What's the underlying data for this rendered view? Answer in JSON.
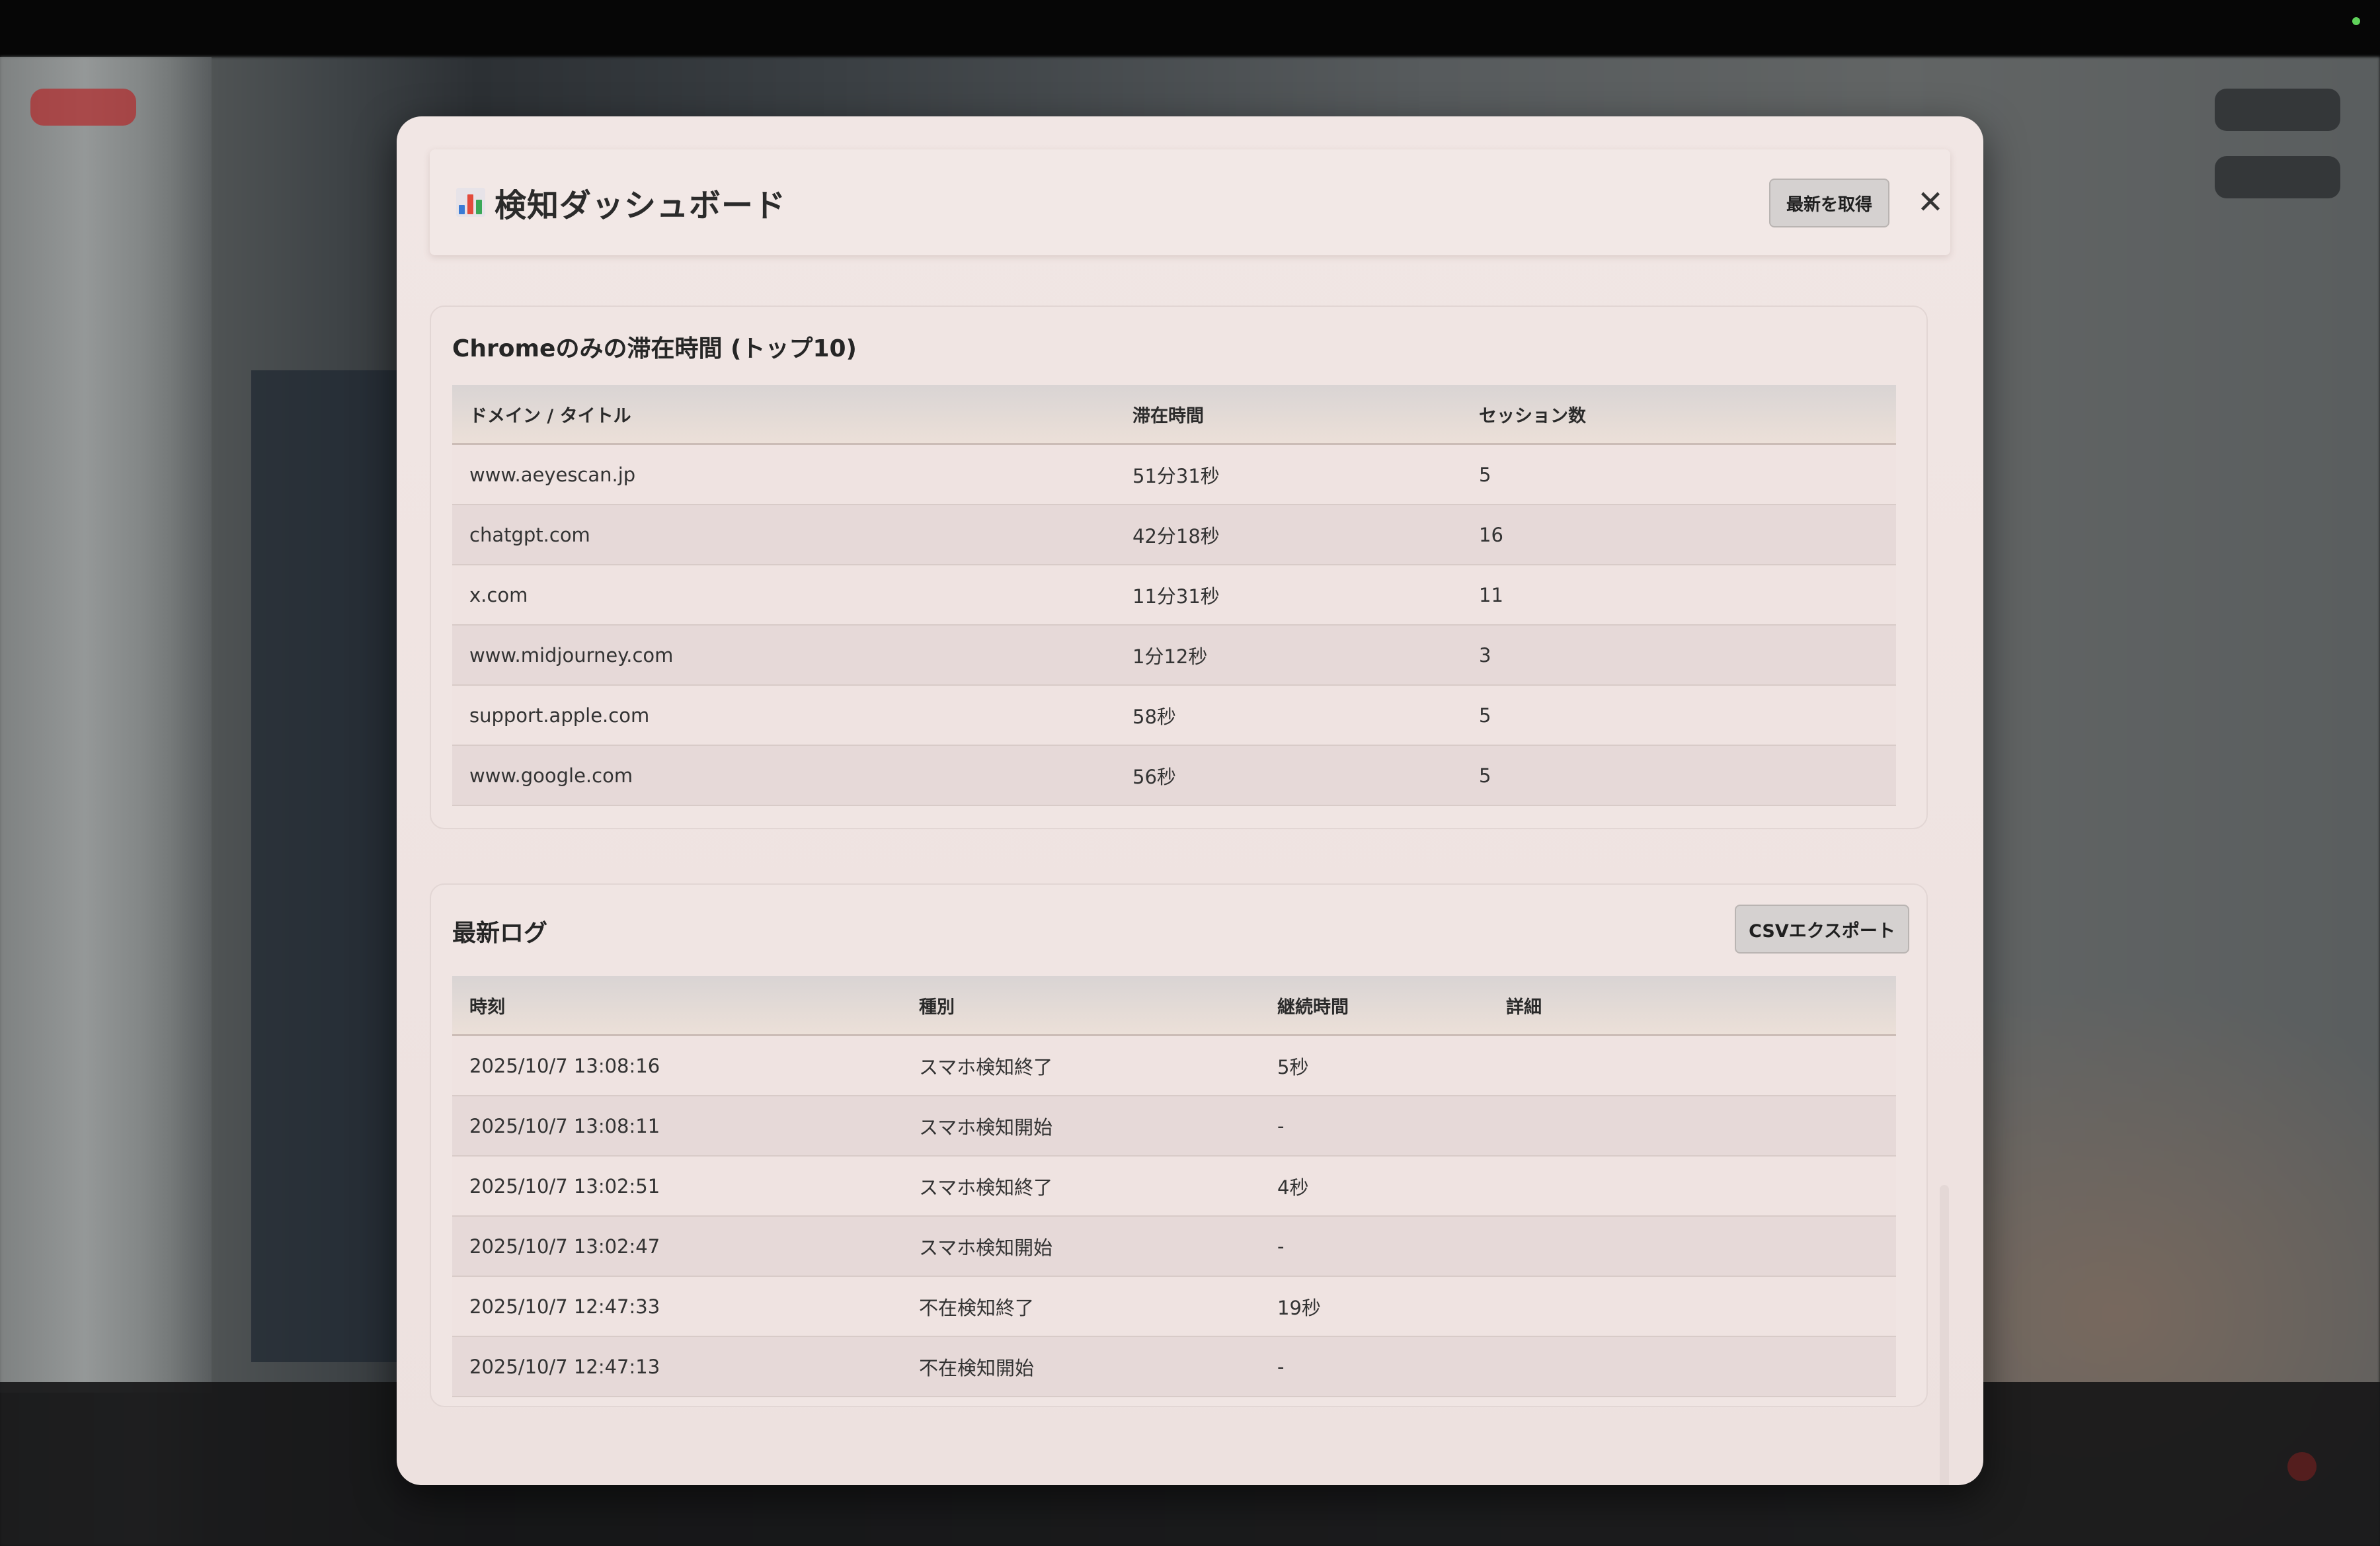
{
  "dashboard": {
    "title": "検知ダッシュボード",
    "refresh_label": "最新を取得",
    "close_label": "✕"
  },
  "chrome_section": {
    "title": "Chromeのみの滞在時間 (トップ10)",
    "columns": [
      "ドメイン / タイトル",
      "滞在時間",
      "セッション数"
    ],
    "rows": [
      {
        "domain": "www.aeyescan.jp",
        "time": "51分31秒",
        "sessions": "5"
      },
      {
        "domain": "chatgpt.com",
        "time": "42分18秒",
        "sessions": "16"
      },
      {
        "domain": "x.com",
        "time": "11分31秒",
        "sessions": "11"
      },
      {
        "domain": "www.midjourney.com",
        "time": "1分12秒",
        "sessions": "3"
      },
      {
        "domain": "support.apple.com",
        "time": "58秒",
        "sessions": "5"
      },
      {
        "domain": "www.google.com",
        "time": "56秒",
        "sessions": "5"
      }
    ]
  },
  "log_section": {
    "title": "最新ログ",
    "csv_label": "CSVエクスポート",
    "columns": [
      "時刻",
      "種別",
      "継続時間",
      "詳細"
    ],
    "rows": [
      {
        "time": "2025/10/7 13:08:16",
        "type": "スマホ検知終了",
        "duration": "5秒",
        "detail": ""
      },
      {
        "time": "2025/10/7 13:08:11",
        "type": "スマホ検知開始",
        "duration": "-",
        "detail": ""
      },
      {
        "time": "2025/10/7 13:02:51",
        "type": "スマホ検知終了",
        "duration": "4秒",
        "detail": ""
      },
      {
        "time": "2025/10/7 13:02:47",
        "type": "スマホ検知開始",
        "duration": "-",
        "detail": ""
      },
      {
        "time": "2025/10/7 12:47:33",
        "type": "不在検知終了",
        "duration": "19秒",
        "detail": ""
      },
      {
        "time": "2025/10/7 12:47:13",
        "type": "不在検知開始",
        "duration": "-",
        "detail": ""
      }
    ]
  },
  "colors": {
    "modal_bg": "#f1e6e4",
    "header_row": "#d9d4d4",
    "button_bg": "#d5d1d0",
    "status_dot": "#5fd25a"
  }
}
